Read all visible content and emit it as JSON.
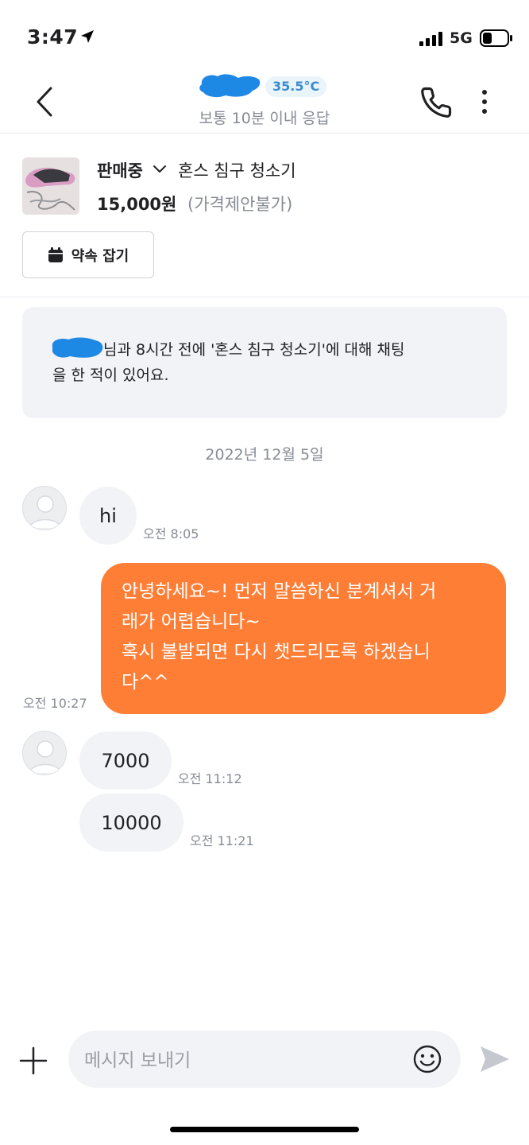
{
  "status_bar": {
    "time": "3:47",
    "network": "5G"
  },
  "header": {
    "temperature": "35.5°C",
    "response_time": "보통 10분 이내 응답"
  },
  "product": {
    "status": "판매중",
    "title": "혼스 침구 청소기",
    "price": "15,000원",
    "price_note": "(가격제안불가)",
    "appointment_button": "약속 잡기"
  },
  "notice": {
    "line1": "님과 8시간 전에 '혼스 침구 청소기'에 대해 채팅",
    "line2": "을 한 적이 있어요."
  },
  "chat": {
    "date": "2022년 12월 5일",
    "messages": [
      {
        "text": "hi",
        "time": "오전 8:05"
      },
      {
        "line1": "안녕하세요~! 먼저 말씀하신 분계셔서 거",
        "line2": "래가 어렵습니다~",
        "line3": "혹시 불발되면 다시 챗드리도록 하겠습니",
        "line4": "다^^",
        "time": "오전 10:27"
      },
      {
        "text": "7000",
        "time": "오전 11:12"
      },
      {
        "text": "10000",
        "time": "오전 11:21"
      }
    ]
  },
  "input": {
    "placeholder": "메시지 보내기"
  },
  "colors": {
    "accent": "#ff7e36",
    "temperature": "#3a8ccf",
    "censor": "#1e88e5"
  }
}
